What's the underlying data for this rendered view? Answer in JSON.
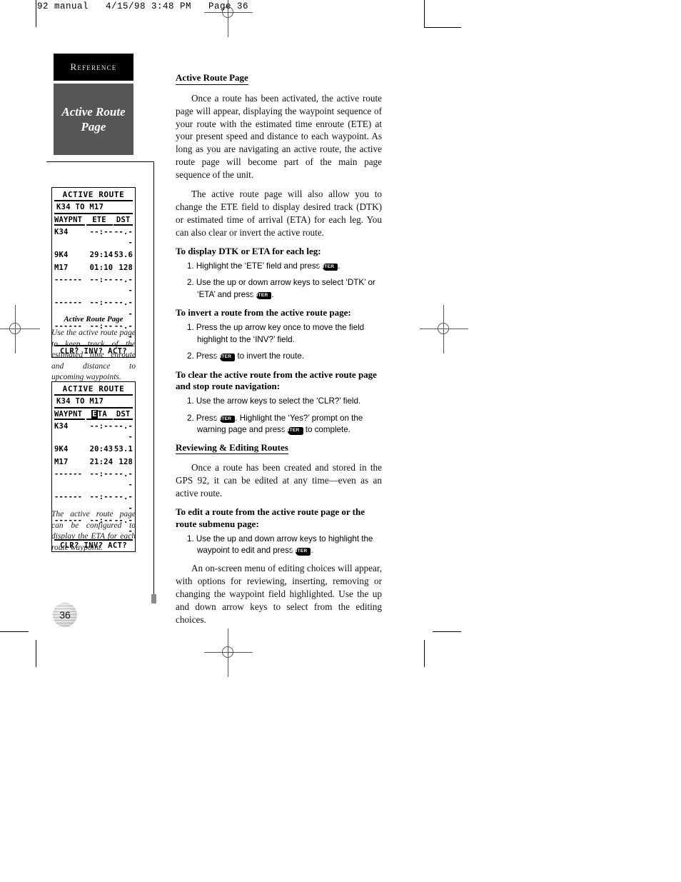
{
  "slug": "92 manual   4/15/98 3:48 PM   Page 36",
  "sidebar": {
    "section_tab": "Reference",
    "topic_tab": "Active Route\nPage",
    "page_number": "36"
  },
  "figures": [
    {
      "name": "active-route-ete",
      "lcd": {
        "title": "ACTIVE ROUTE",
        "subtitle": "K34 TO M17",
        "headers": [
          "WAYPNT",
          "ETE",
          "DST"
        ],
        "header_highlight": "",
        "rows": [
          {
            "waypnt": "K34",
            "time": "--:--",
            "dst": "--.--"
          },
          {
            "waypnt": "9K4",
            "time": "29:14",
            "dst": "53.6"
          },
          {
            "waypnt": "M17",
            "time": "01:10",
            "dst": "128"
          },
          {
            "waypnt": "------",
            "time": "--:--",
            "dst": "--.--"
          },
          {
            "waypnt": "------",
            "time": "--:--",
            "dst": "--.--"
          },
          {
            "waypnt": "------",
            "time": "--:--",
            "dst": "--.--"
          }
        ],
        "footer": "CLR? INV? ACT?"
      },
      "caption_title": "Active Route Page",
      "caption_body": "Use the active route page to keep track of the estimated time enroute and distance to upcoming waypoints."
    },
    {
      "name": "active-route-eta",
      "lcd": {
        "title": "ACTIVE ROUTE",
        "subtitle": "K34 TO M17",
        "headers": [
          "WAYPNT",
          "ETA",
          "DST"
        ],
        "header_highlight": "E",
        "header_rest": "TA",
        "rows": [
          {
            "waypnt": "K34",
            "time": "--:--",
            "dst": "--.--"
          },
          {
            "waypnt": "9K4",
            "time": "20:43",
            "dst": "53.1"
          },
          {
            "waypnt": "M17",
            "time": "21:24",
            "dst": "128"
          },
          {
            "waypnt": "------",
            "time": "--:--",
            "dst": "--.--"
          },
          {
            "waypnt": "------",
            "time": "--:--",
            "dst": "--.--"
          },
          {
            "waypnt": "------",
            "time": "--:--",
            "dst": "--.--"
          }
        ],
        "footer": "CLR? INV? ACT?"
      },
      "caption_title": "",
      "caption_body": "The active route page can be configured to display the ETA for each route waypoint."
    }
  ],
  "main": {
    "heading1": "Active Route Page",
    "para1": "Once a route has been activated, the active route page will appear, displaying the waypoint sequence of your route with the estimated time enroute (ETE) at your present speed and distance to each waypoint. As long as you are navigating an active route, the active route page will become part of the main page sequence of the unit.",
    "para2": "The active route page will also allow you to change the ETE field to display desired track (DTK) or estimated time of arrival (ETA) for each leg. You can also clear or invert the active route.",
    "proc1_head": "To display DTK or ETA for each leg:",
    "proc1_step1_a": "1. Highlight the ‘ETE’ field and press",
    "proc1_step1_key": "ENTER",
    "proc1_step1_b": ".",
    "proc1_step2_a": "2. Use the up or down arrow keys to select ‘DTK’ or ‘ETA’ and press",
    "proc1_step2_key": "ENTER",
    "proc1_step2_b": ".",
    "proc2_head": "To invert a route from the active route page:",
    "proc2_step1": "1. Press the up arrow key once to move the field highlight to the ‘INV?’ field.",
    "proc2_step2_a": "2. Press",
    "proc2_step2_key": "ENTER",
    "proc2_step2_b": "to invert the route.",
    "proc3_head": "To clear the active route from the active route page and stop route navigation:",
    "proc3_step1": "1. Use the arrow keys to select the ‘CLR?’ field.",
    "proc3_step2_a": "2. Press",
    "proc3_step2_key": "ENTER",
    "proc3_step2_b": ". Highlight the ‘Yes?’ prompt on the warning page and press",
    "proc3_step2_key2": "ENTER",
    "proc3_step2_c": "to complete.",
    "heading2": "Reviewing & Editing Routes",
    "para3": "Once a route has been created and stored in the GPS 92, it can be edited at any time—even as an active route.",
    "proc4_head": "To edit a route from the active route page or the route submenu page:",
    "proc4_step1_a": "1. Use the up and down arrow keys to highlight the waypoint to edit and press",
    "proc4_step1_key": "ENTER",
    "proc4_step1_b": ".",
    "para4": "An on-screen menu of editing choices will appear, with options for reviewing, inserting, removing or changing the waypoint field highlighted. Use the up and down arrow keys to select from the editing choices."
  }
}
